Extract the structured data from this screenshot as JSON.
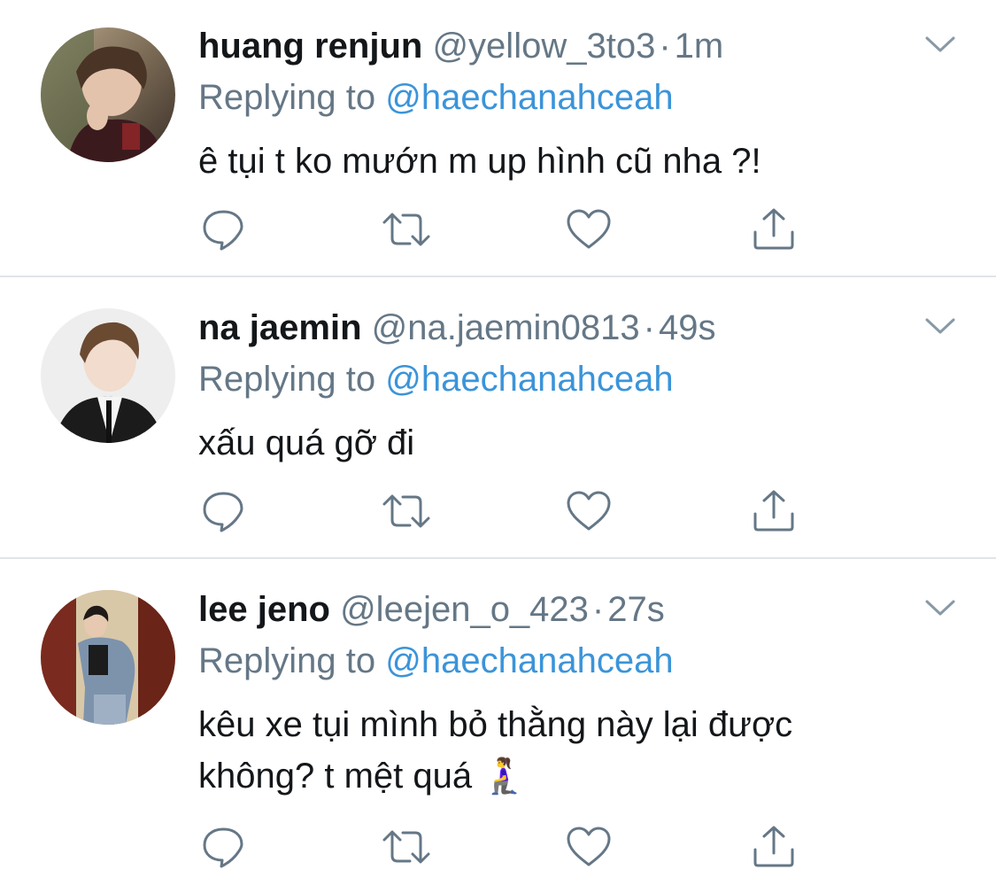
{
  "tweets": [
    {
      "name": "huang renjun",
      "handle": "@yellow_3to3",
      "separator": "·",
      "time": "1m",
      "replying_label": "Replying to",
      "replying_to": "@haechanahceah",
      "text": "ê tụi t ko mướn m up hình cũ nha ?!"
    },
    {
      "name": "na jaemin",
      "handle": "@na.jaemin0813",
      "separator": "·",
      "time": "49s",
      "replying_label": "Replying to",
      "replying_to": "@haechanahceah",
      "text": "xấu quá gỡ đi"
    },
    {
      "name": "lee jeno",
      "handle": "@leejen_o_423",
      "separator": "·",
      "time": "27s",
      "replying_label": "Replying to",
      "replying_to": "@haechanahceah",
      "text_line1": "kêu xe tụi mình bỏ thằng này lại được",
      "text_line2": "không? t mệt quá 🧎‍♀️"
    }
  ],
  "icons": {
    "reply": "speech-bubble-icon",
    "retweet": "retweet-arrows-icon",
    "like": "heart-icon",
    "share": "share-upload-icon",
    "more": "chevron-down-icon"
  },
  "colors": {
    "text": "#14171a",
    "secondary": "#657786",
    "mention": "#3b94d9",
    "icon": "#657786",
    "divider": "#e1e4e8"
  }
}
